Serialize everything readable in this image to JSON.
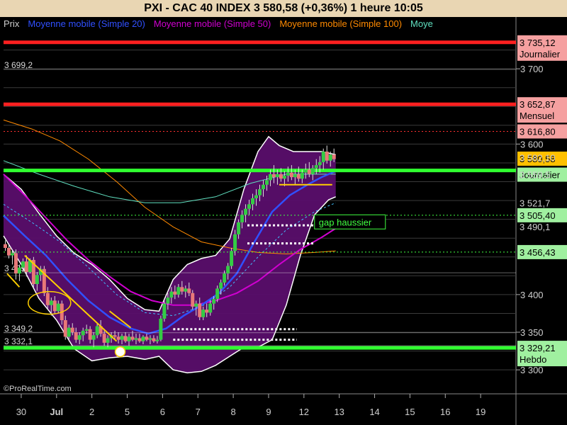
{
  "window": {
    "title": "PXI - CAC 40 INDEX     3 580,58 (+0,36%)     1 heure  10:05"
  },
  "chart_data": {
    "type": "candlestick",
    "title": "PXI - CAC 40 INDEX     3 580,58 (+0,36%)     1 heure  10:05",
    "legend": [
      {
        "name": "Prix",
        "color": "#cfcfcf"
      },
      {
        "name": "Moyenne mobile (Simple 20)",
        "color": "#3050ff"
      },
      {
        "name": "Moyenne mobile (Simple 50)",
        "color": "#d000d0"
      },
      {
        "name": "Moyenne mobile (Simple 100)",
        "color": "#ff8a00"
      },
      {
        "name": "Moye",
        "color": "#60e0c0"
      }
    ],
    "x_ticks": [
      {
        "label": "30",
        "pos": 0.5
      },
      {
        "label": "Jul",
        "pos": 1.5,
        "bold": true
      },
      {
        "label": "2",
        "pos": 2.5
      },
      {
        "label": "5",
        "pos": 3.5
      },
      {
        "label": "6",
        "pos": 4.5
      },
      {
        "label": "7",
        "pos": 5.5
      },
      {
        "label": "8",
        "pos": 6.5
      },
      {
        "label": "9",
        "pos": 7.5
      },
      {
        "label": "12",
        "pos": 8.5
      },
      {
        "label": "13",
        "pos": 9.5
      },
      {
        "label": "14",
        "pos": 10.5
      },
      {
        "label": "15",
        "pos": 11.5
      },
      {
        "label": "16",
        "pos": 12.5
      },
      {
        "label": "19",
        "pos": 13.5
      }
    ],
    "x_range": [
      0,
      14.5
    ],
    "y_range": [
      3270,
      3750
    ],
    "y_ticks": [
      {
        "value": 3300,
        "label": "3 300"
      },
      {
        "value": 3350,
        "label": "3 350"
      },
      {
        "value": 3400,
        "label": "3 400"
      },
      {
        "value": 3600,
        "label": "3 600"
      },
      {
        "value": 3700,
        "label": "3 700"
      }
    ],
    "price_levels": [
      {
        "value": 3735.12,
        "label": "3 735,12",
        "sublabel": "Journalier",
        "color": "#ff2020",
        "style": "thick",
        "box": "#f5a0a0"
      },
      {
        "value": 3699.2,
        "label": "3 699,2",
        "style": "thin",
        "color": "#e0e0e0",
        "side": "left"
      },
      {
        "value": 3652.87,
        "label": "3 652,87",
        "sublabel": "Mensuel",
        "color": "#ff2020",
        "style": "thick",
        "box": "#f5a0a0"
      },
      {
        "value": 3616.8,
        "label": "3 616,80",
        "color": "#ff3030",
        "style": "dotted",
        "box": "#f5a0a0"
      },
      {
        "value": 3580.58,
        "label": "3 580,58",
        "color": "#ffc000",
        "style": "none",
        "box": "#ffc000"
      },
      {
        "value": 3565.0,
        "label": "",
        "sublabel": "Journalier",
        "color": "#30ff30",
        "style": "thick",
        "box": "#a0f0a0"
      },
      {
        "value": 3505.4,
        "label": "3 505,40",
        "color": "#40ff40",
        "style": "dotted",
        "box": "#a0f0a0"
      },
      {
        "value": 3456.43,
        "label": "3 456,43",
        "color": "#40ff40",
        "style": "dotted",
        "box": "#a0f0a0"
      },
      {
        "value": 3429.0,
        "label": "3 429",
        "style": "thin",
        "color": "#e0e0e0",
        "side": "left"
      },
      {
        "value": 3349.2,
        "label": "3 349,2",
        "style": "thin",
        "color": "#e0e0e0",
        "side": "left"
      },
      {
        "value": 3332.1,
        "label": "3 332,1",
        "style": "thin",
        "color": "#e0e0e0",
        "side": "left"
      },
      {
        "value": 3329.21,
        "label": "3 329,21",
        "sublabel": "Hebdo",
        "color": "#30ff30",
        "style": "thick",
        "box": "#a0f0a0"
      }
    ],
    "faint_right_labels": [
      "3 582,10",
      "3 559,5",
      "3 521,7",
      "3 490,1"
    ],
    "annotation": {
      "label": "gap haussier",
      "color": "#40ff40"
    },
    "candles": [
      [
        0.05,
        3467,
        3472,
        3458,
        3462
      ],
      [
        0.15,
        3462,
        3466,
        3448,
        3452
      ],
      [
        0.25,
        3452,
        3458,
        3440,
        3455
      ],
      [
        0.35,
        3455,
        3460,
        3420,
        3428
      ],
      [
        0.45,
        3428,
        3440,
        3418,
        3436
      ],
      [
        0.55,
        3436,
        3448,
        3430,
        3444
      ],
      [
        0.65,
        3444,
        3452,
        3424,
        3430
      ],
      [
        0.75,
        3430,
        3448,
        3428,
        3446
      ],
      [
        0.85,
        3446,
        3450,
        3410,
        3414
      ],
      [
        0.95,
        3414,
        3430,
        3405,
        3426
      ],
      [
        1.05,
        3426,
        3438,
        3418,
        3434
      ],
      [
        1.15,
        3434,
        3438,
        3398,
        3402
      ],
      [
        1.25,
        3402,
        3410,
        3380,
        3386
      ],
      [
        1.35,
        3386,
        3396,
        3372,
        3392
      ],
      [
        1.45,
        3392,
        3398,
        3374,
        3378
      ],
      [
        1.55,
        3378,
        3392,
        3375,
        3388
      ],
      [
        1.65,
        3388,
        3392,
        3360,
        3366
      ],
      [
        1.75,
        3366,
        3372,
        3340,
        3344
      ],
      [
        1.85,
        3344,
        3360,
        3338,
        3356
      ],
      [
        1.95,
        3356,
        3362,
        3346,
        3350
      ],
      [
        2.05,
        3350,
        3356,
        3336,
        3340
      ],
      [
        2.15,
        3340,
        3350,
        3334,
        3346
      ],
      [
        2.25,
        3346,
        3356,
        3338,
        3352
      ],
      [
        2.35,
        3352,
        3360,
        3348,
        3354
      ],
      [
        2.45,
        3354,
        3358,
        3335,
        3340
      ],
      [
        2.55,
        3340,
        3350,
        3330,
        3346
      ],
      [
        2.65,
        3346,
        3362,
        3342,
        3358
      ],
      [
        2.75,
        3358,
        3366,
        3344,
        3348
      ],
      [
        2.85,
        3348,
        3354,
        3332,
        3336
      ],
      [
        2.95,
        3336,
        3346,
        3330,
        3342
      ],
      [
        3.05,
        3342,
        3350,
        3336,
        3346
      ],
      [
        3.15,
        3346,
        3352,
        3340,
        3344
      ],
      [
        3.25,
        3344,
        3350,
        3335,
        3340
      ],
      [
        3.35,
        3340,
        3348,
        3334,
        3345
      ],
      [
        3.45,
        3345,
        3350,
        3336,
        3338
      ],
      [
        3.55,
        3338,
        3348,
        3332,
        3344
      ],
      [
        3.65,
        3344,
        3352,
        3338,
        3340
      ],
      [
        3.75,
        3340,
        3348,
        3334,
        3342
      ],
      [
        3.85,
        3342,
        3348,
        3336,
        3338
      ],
      [
        3.95,
        3338,
        3346,
        3334,
        3344
      ],
      [
        4.05,
        3344,
        3348,
        3338,
        3340
      ],
      [
        4.15,
        3340,
        3346,
        3334,
        3342
      ],
      [
        4.25,
        3342,
        3346,
        3336,
        3338
      ],
      [
        4.35,
        3338,
        3345,
        3335,
        3340
      ],
      [
        4.45,
        3340,
        3372,
        3338,
        3368
      ],
      [
        4.55,
        3368,
        3392,
        3364,
        3388
      ],
      [
        4.65,
        3388,
        3402,
        3380,
        3396
      ],
      [
        4.75,
        3396,
        3410,
        3388,
        3404
      ],
      [
        4.85,
        3404,
        3412,
        3394,
        3400
      ],
      [
        4.95,
        3400,
        3414,
        3396,
        3410
      ],
      [
        5.05,
        3410,
        3418,
        3400,
        3404
      ],
      [
        5.15,
        3404,
        3412,
        3396,
        3408
      ],
      [
        5.25,
        3408,
        3416,
        3398,
        3402
      ],
      [
        5.35,
        3402,
        3406,
        3380,
        3384
      ],
      [
        5.45,
        3384,
        3392,
        3372,
        3388
      ],
      [
        5.55,
        3388,
        3396,
        3366,
        3370
      ],
      [
        5.65,
        3370,
        3384,
        3366,
        3380
      ],
      [
        5.75,
        3380,
        3388,
        3370,
        3376
      ],
      [
        5.85,
        3376,
        3392,
        3372,
        3388
      ],
      [
        5.95,
        3388,
        3398,
        3380,
        3394
      ],
      [
        6.05,
        3394,
        3412,
        3390,
        3408
      ],
      [
        6.15,
        3408,
        3420,
        3400,
        3416
      ],
      [
        6.25,
        3416,
        3432,
        3412,
        3428
      ],
      [
        6.35,
        3428,
        3442,
        3420,
        3438
      ],
      [
        6.45,
        3438,
        3462,
        3434,
        3458
      ],
      [
        6.55,
        3458,
        3486,
        3452,
        3480
      ],
      [
        6.65,
        3480,
        3500,
        3474,
        3496
      ],
      [
        6.75,
        3496,
        3512,
        3488,
        3506
      ],
      [
        6.85,
        3506,
        3520,
        3496,
        3514
      ],
      [
        6.95,
        3514,
        3526,
        3506,
        3520
      ],
      [
        7.05,
        3520,
        3534,
        3512,
        3528
      ],
      [
        7.15,
        3528,
        3540,
        3518,
        3532
      ],
      [
        7.25,
        3532,
        3546,
        3524,
        3540
      ],
      [
        7.35,
        3540,
        3552,
        3530,
        3546
      ],
      [
        7.45,
        3546,
        3558,
        3538,
        3552
      ],
      [
        7.55,
        3552,
        3566,
        3544,
        3560
      ],
      [
        7.65,
        3560,
        3572,
        3548,
        3556
      ],
      [
        7.75,
        3556,
        3566,
        3546,
        3560
      ],
      [
        7.85,
        3560,
        3568,
        3550,
        3554
      ],
      [
        7.95,
        3554,
        3564,
        3544,
        3558
      ],
      [
        8.05,
        3558,
        3570,
        3550,
        3562
      ],
      [
        8.15,
        3562,
        3572,
        3552,
        3556
      ],
      [
        8.25,
        3556,
        3566,
        3546,
        3560
      ],
      [
        8.35,
        3560,
        3570,
        3550,
        3554
      ],
      [
        8.45,
        3554,
        3566,
        3548,
        3562
      ],
      [
        8.55,
        3562,
        3574,
        3554,
        3566
      ],
      [
        8.65,
        3566,
        3576,
        3556,
        3560
      ],
      [
        8.75,
        3560,
        3572,
        3552,
        3568
      ],
      [
        8.85,
        3568,
        3580,
        3560,
        3572
      ],
      [
        8.95,
        3572,
        3584,
        3562,
        3576
      ],
      [
        9.05,
        3576,
        3594,
        3566,
        3590
      ],
      [
        9.15,
        3590,
        3598,
        3574,
        3578
      ],
      [
        9.25,
        3578,
        3590,
        3570,
        3586
      ],
      [
        9.35,
        3586,
        3594,
        3576,
        3580
      ]
    ]
  }
}
